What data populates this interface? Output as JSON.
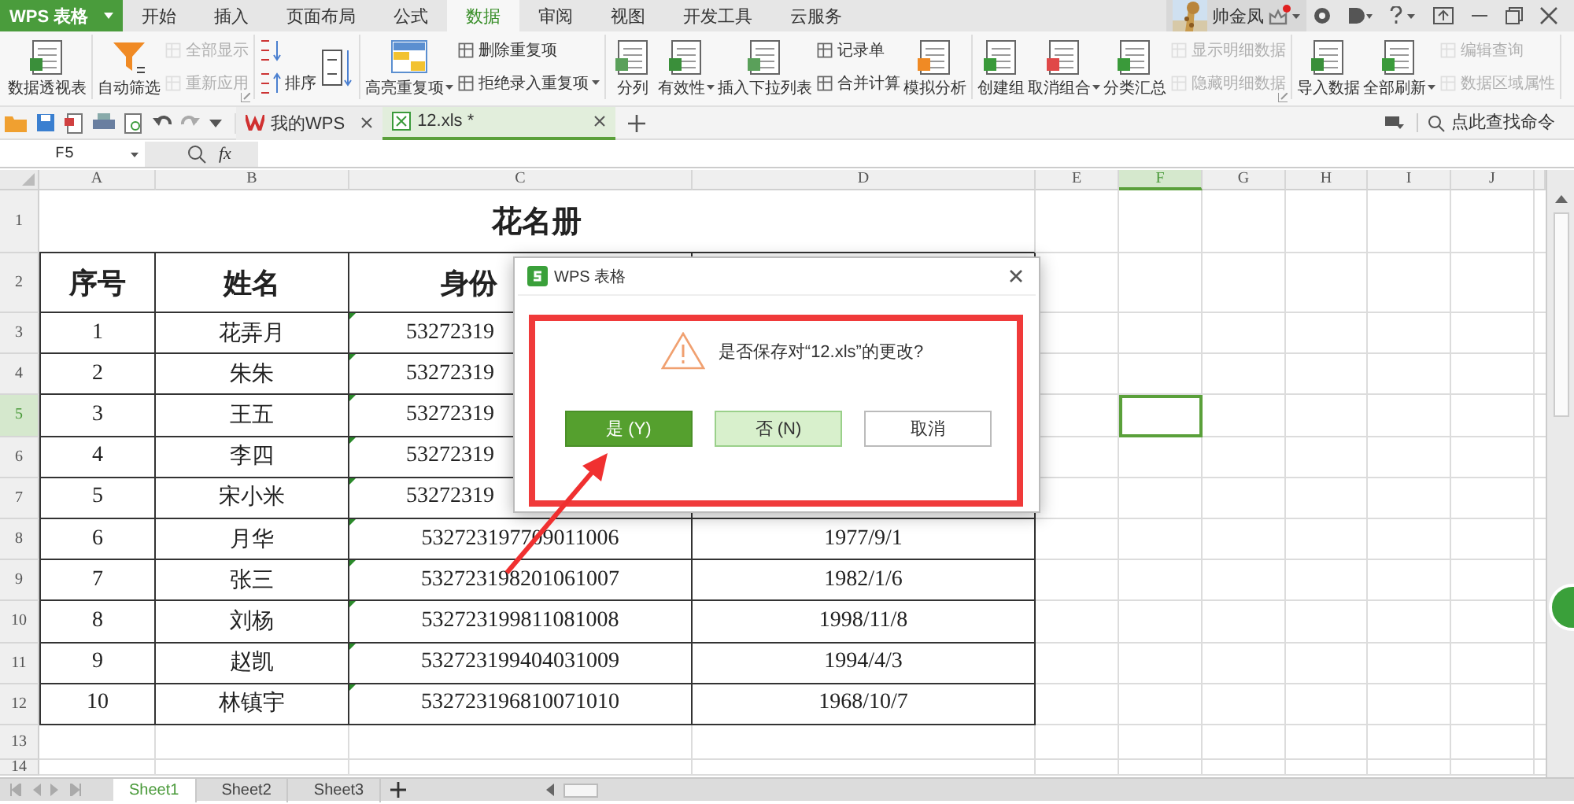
{
  "app_button": {
    "label": "WPS 表格"
  },
  "menu_tabs": [
    {
      "label": "开始",
      "selected": false
    },
    {
      "label": "插入",
      "selected": false
    },
    {
      "label": "页面布局",
      "selected": false
    },
    {
      "label": "公式",
      "selected": false
    },
    {
      "label": "数据",
      "selected": true
    },
    {
      "label": "审阅",
      "selected": false
    },
    {
      "label": "视图",
      "selected": false
    },
    {
      "label": "开发工具",
      "selected": false
    },
    {
      "label": "云服务",
      "selected": false
    }
  ],
  "user": {
    "name": "帅金凤",
    "notification": true
  },
  "ribbon": {
    "groups": [
      {
        "columns": [
          [
            {
              "kind": "large",
              "label": "数据透视表",
              "disabled": false
            }
          ]
        ]
      },
      {
        "launcher": true,
        "columns": [
          [
            {
              "kind": "large",
              "label": "自动筛选",
              "disabled": false
            }
          ],
          [
            {
              "kind": "small",
              "label": "全部显示",
              "disabled": true
            },
            {
              "kind": "small",
              "label": "重新应用",
              "disabled": true
            }
          ]
        ]
      },
      {
        "columns": [
          [
            {
              "kind": "icon",
              "disabled": false
            },
            {
              "kind": "small",
              "label": "排序",
              "disabled": false
            }
          ],
          [
            {
              "kind": "icon",
              "disabled": false
            }
          ]
        ]
      },
      {
        "columns": [
          [
            {
              "kind": "large",
              "label": "高亮重复项",
              "disabled": false,
              "dropdown": true
            }
          ],
          [
            {
              "kind": "small",
              "label": "删除重复项",
              "disabled": false
            },
            {
              "kind": "small",
              "label": "拒绝录入重复项",
              "disabled": false,
              "dropdown": true
            }
          ]
        ]
      },
      {
        "columns": [
          [
            {
              "kind": "large",
              "label": "分列",
              "disabled": false
            }
          ],
          [
            {
              "kind": "large",
              "label": "有效性",
              "disabled": false,
              "dropdown": true
            }
          ],
          [
            {
              "kind": "large",
              "label": "插入下拉列表",
              "disabled": false
            }
          ],
          [
            {
              "kind": "small",
              "label": "记录单",
              "disabled": false
            },
            {
              "kind": "small",
              "label": "合并计算",
              "disabled": false
            }
          ],
          [
            {
              "kind": "large",
              "label": "模拟分析",
              "disabled": false
            }
          ]
        ]
      },
      {
        "launcher": true,
        "columns": [
          [
            {
              "kind": "large",
              "label": "创建组",
              "disabled": false
            }
          ],
          [
            {
              "kind": "large",
              "label": "取消组合",
              "disabled": false,
              "dropdown": true
            }
          ],
          [
            {
              "kind": "large",
              "label": "分类汇总",
              "disabled": false
            }
          ],
          [
            {
              "kind": "small",
              "label": "显示明细数据",
              "disabled": true
            },
            {
              "kind": "small",
              "label": "隐藏明细数据",
              "disabled": true
            }
          ]
        ]
      },
      {
        "columns": [
          [
            {
              "kind": "large",
              "label": "导入数据",
              "disabled": false
            }
          ],
          [
            {
              "kind": "large",
              "label": "全部刷新",
              "disabled": false,
              "dropdown": true
            }
          ],
          [
            {
              "kind": "small",
              "label": "编辑查询",
              "disabled": true
            },
            {
              "kind": "small",
              "label": "数据区域属性",
              "disabled": true
            }
          ]
        ]
      }
    ]
  },
  "doc_tabs": [
    {
      "label": "我的WPS",
      "selected": false
    },
    {
      "label": "12.xls *",
      "selected": true
    }
  ],
  "command_search": {
    "placeholder": "点此查找命令"
  },
  "formula_bar": {
    "cell_ref": "F5",
    "fx": "fx"
  },
  "sheet": {
    "columns": [
      {
        "label": "A",
        "selected": false
      },
      {
        "label": "B",
        "selected": false
      },
      {
        "label": "C",
        "selected": false
      },
      {
        "label": "D",
        "selected": false
      },
      {
        "label": "E",
        "selected": false
      },
      {
        "label": "F",
        "selected": true
      },
      {
        "label": "G",
        "selected": false
      },
      {
        "label": "H",
        "selected": false
      },
      {
        "label": "I",
        "selected": false
      },
      {
        "label": "J",
        "selected": false
      }
    ],
    "rows": [
      {
        "number": "1",
        "selected": false,
        "kind": "title",
        "cells": [
          "花名册"
        ]
      },
      {
        "number": "2",
        "selected": false,
        "kind": "header",
        "clipped": true,
        "cells": [
          "序号",
          "姓名",
          "身份"
        ]
      },
      {
        "number": "3",
        "selected": false,
        "kind": "data",
        "clipped": true,
        "cells": [
          "1",
          "花弄月",
          "53272319"
        ]
      },
      {
        "number": "4",
        "selected": false,
        "kind": "data",
        "clipped": true,
        "cells": [
          "2",
          "朱朱",
          "53272319"
        ]
      },
      {
        "number": "5",
        "selected": true,
        "kind": "data",
        "clipped": true,
        "cells": [
          "3",
          "王五",
          "53272319"
        ]
      },
      {
        "number": "6",
        "selected": false,
        "kind": "data",
        "clipped": true,
        "cells": [
          "4",
          "李四",
          "53272319"
        ]
      },
      {
        "number": "7",
        "selected": false,
        "kind": "data",
        "clipped": true,
        "cells": [
          "5",
          "宋小米",
          "53272319"
        ]
      },
      {
        "number": "8",
        "selected": false,
        "kind": "data",
        "cells": [
          "6",
          "月华",
          "532723197709011006",
          "1977/9/1"
        ]
      },
      {
        "number": "9",
        "selected": false,
        "kind": "data",
        "cells": [
          "7",
          "张三",
          "532723198201061007",
          "1982/1/6"
        ]
      },
      {
        "number": "10",
        "selected": false,
        "kind": "data",
        "cells": [
          "8",
          "刘杨",
          "532723199811081008",
          "1998/11/8"
        ]
      },
      {
        "number": "11",
        "selected": false,
        "kind": "data",
        "cells": [
          "9",
          "赵凯",
          "532723199404031009",
          "1994/4/3"
        ]
      },
      {
        "number": "12",
        "selected": false,
        "kind": "data",
        "cells": [
          "10",
          "林镇宇",
          "532723196810071010",
          "1968/10/7"
        ]
      },
      {
        "number": "13",
        "selected": false,
        "kind": "blank"
      },
      {
        "number": "14",
        "selected": false,
        "kind": "blank"
      }
    ]
  },
  "sheet_tabs": [
    {
      "label": "Sheet1",
      "selected": true
    },
    {
      "label": "Sheet2",
      "selected": false
    },
    {
      "label": "Sheet3",
      "selected": false
    }
  ],
  "dialog": {
    "title": "WPS 表格",
    "message": "是否保存对“12.xls”的更改?",
    "buttons": [
      {
        "label": "是 (Y)",
        "kind": "primary"
      },
      {
        "label": "否 (N)",
        "kind": "secondary"
      },
      {
        "label": "取消",
        "kind": "plain"
      }
    ]
  }
}
